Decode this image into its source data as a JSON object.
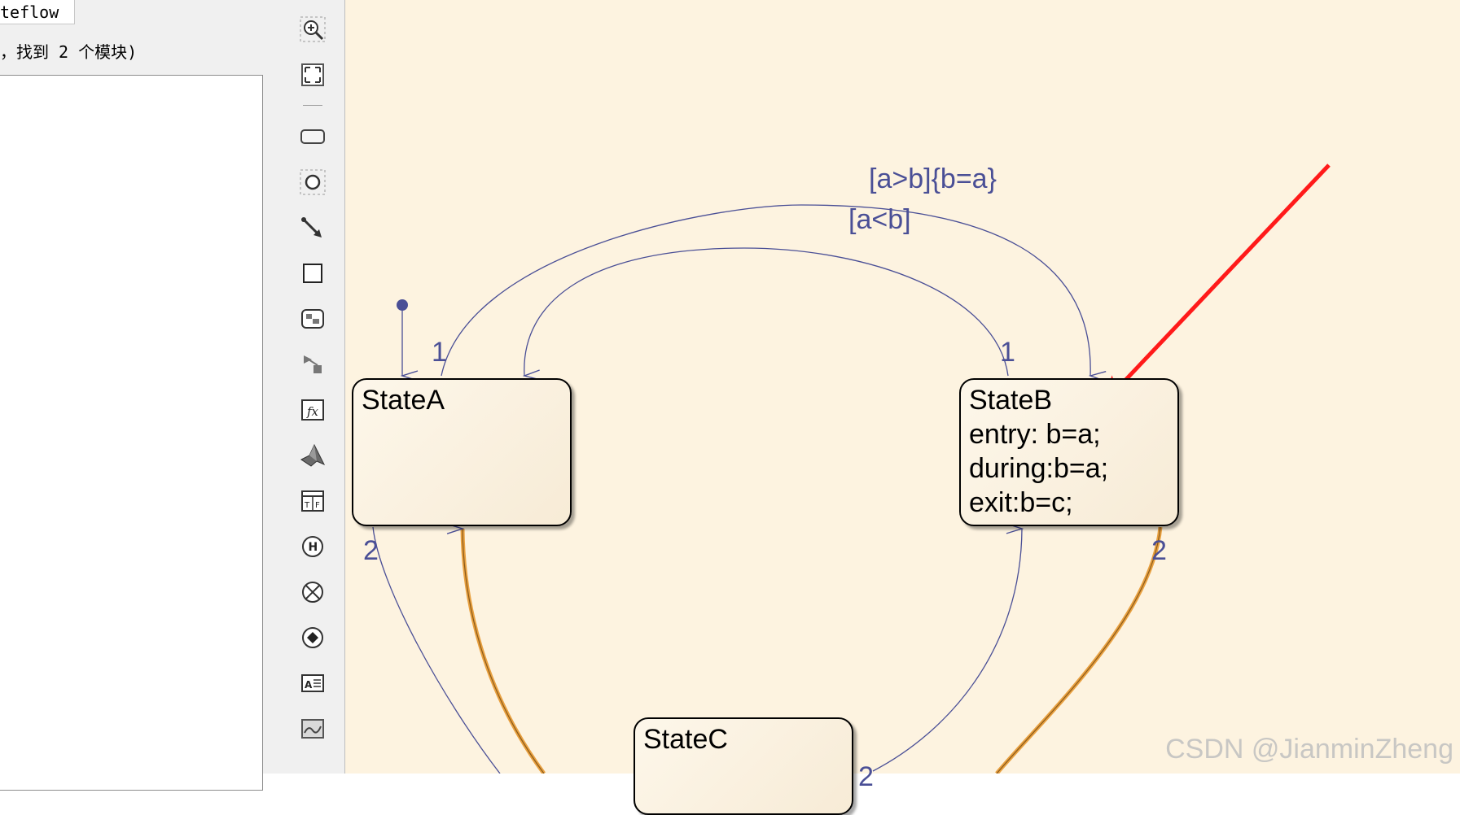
{
  "left_panel": {
    "tab_label": "teflow",
    "status_text": "，找到 2 个模块)"
  },
  "toolbar": {
    "tools": [
      {
        "icon": "zoom-in-icon"
      },
      {
        "icon": "fit-view-icon"
      },
      {
        "icon": "state-tool-icon"
      },
      {
        "icon": "junction-tool-icon"
      },
      {
        "icon": "default-transition-tool-icon"
      },
      {
        "icon": "box-tool-icon"
      },
      {
        "icon": "image-tool-icon"
      },
      {
        "icon": "simulink-function-tool-icon"
      },
      {
        "icon": "graphical-function-tool-icon"
      },
      {
        "icon": "matlab-function-tool-icon"
      },
      {
        "icon": "truth-table-tool-icon"
      },
      {
        "icon": "history-junction-tool-icon"
      },
      {
        "icon": "exit-junction-tool-icon"
      },
      {
        "icon": "entry-junction-tool-icon"
      },
      {
        "icon": "annotation-tool-icon"
      },
      {
        "icon": "chart-view-tool-icon"
      }
    ]
  },
  "diagram": {
    "states": {
      "state_a": {
        "name": "StateA",
        "actions": []
      },
      "state_b": {
        "name": "StateB",
        "actions": [
          "entry: b=a;",
          "during:b=a;",
          "exit:b=c;"
        ]
      },
      "state_c": {
        "name": "StateC",
        "actions": []
      }
    },
    "transitions": {
      "a_to_b_condition": "[a>b]{b=a}",
      "b_to_a_condition": "[a<b]",
      "a_top_order": "1",
      "b_top_order": "1",
      "a_bottom_order": "2",
      "b_bottom_order": "2",
      "c_order": "2"
    },
    "colors": {
      "canvas": "#fdf3e0",
      "transition": "#4a4f96",
      "highlight": "#e8a040",
      "annotation_arrow": "#ff1a1a"
    }
  },
  "watermark": "CSDN @JianminZheng"
}
